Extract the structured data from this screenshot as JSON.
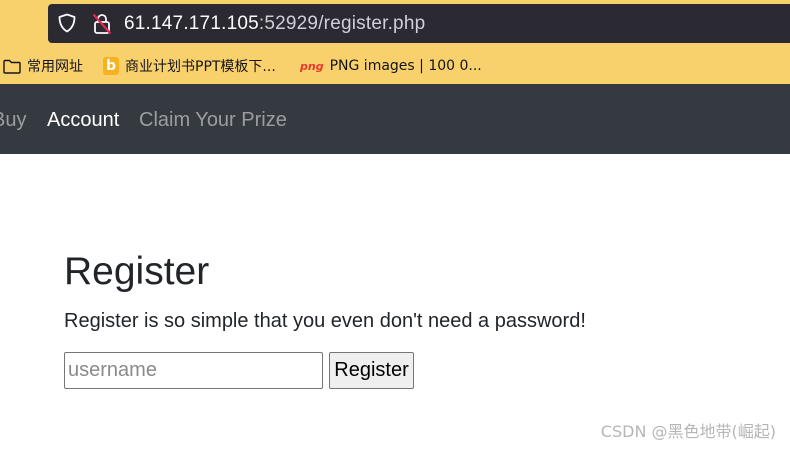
{
  "browser": {
    "url_host": "61.147.171.105",
    "url_rest": ":52929/register.php",
    "bookmarks": [
      {
        "label": "常用网址",
        "icon": "folder-icon"
      },
      {
        "label": "商业计划书PPT模板下...",
        "icon": "b-favicon"
      },
      {
        "label": "PNG images | 100 0...",
        "icon": "png-favicon",
        "icon_text": "png"
      }
    ]
  },
  "navbar": {
    "items": [
      {
        "label": "Buy",
        "active": false
      },
      {
        "label": "Account",
        "active": true
      },
      {
        "label": "Claim Your Prize",
        "active": false
      }
    ]
  },
  "main": {
    "title": "Register",
    "description": "Register is so simple that you even don't need a password!",
    "username_placeholder": "username",
    "username_value": "",
    "register_button": "Register"
  },
  "watermark": "CSDN @黑色地带(崛起)",
  "colors": {
    "chrome_bg": "#f9d16c",
    "urlbar_bg": "#2b2a33",
    "navbar_bg": "#343a40",
    "text": "#212529"
  }
}
